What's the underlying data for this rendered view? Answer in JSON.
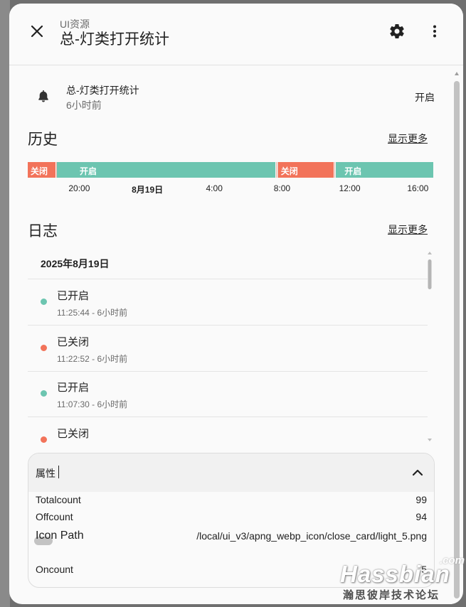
{
  "header": {
    "subtitle": "UI资源",
    "title": "总-灯类打开统计",
    "close_icon": "close-icon",
    "settings_icon": "gear-icon",
    "more_icon": "more-vertical-icon"
  },
  "entity": {
    "icon": "bell-icon",
    "name": "总-灯类打开统计",
    "last_changed": "6小时前",
    "state": "开启"
  },
  "history": {
    "title": "历史",
    "show_more": "显示更多",
    "segments": [
      {
        "state": "off",
        "label": "关闭",
        "start": 0.0,
        "end": 0.068
      },
      {
        "state": "on",
        "label": "开启",
        "start": 0.072,
        "end": 0.61
      },
      {
        "state": "off",
        "label": "关闭",
        "start": 0.617,
        "end": 0.755
      },
      {
        "state": "on",
        "label": "开启",
        "start": 0.76,
        "end": 1.0
      }
    ],
    "ticks": [
      {
        "label": "20:00",
        "pos": 0.127,
        "bold": false
      },
      {
        "label": "8月19日",
        "pos": 0.295,
        "bold": true
      },
      {
        "label": "4:00",
        "pos": 0.46,
        "bold": false
      },
      {
        "label": "8:00",
        "pos": 0.627,
        "bold": false
      },
      {
        "label": "12:00",
        "pos": 0.794,
        "bold": false
      },
      {
        "label": "16:00",
        "pos": 0.962,
        "bold": false
      }
    ]
  },
  "logbook": {
    "title": "日志",
    "show_more": "显示更多",
    "date": "2025年8月19日",
    "entries": [
      {
        "message": "已开启",
        "time": "11:25:44 - 6小时前",
        "state": "on"
      },
      {
        "message": "已关闭",
        "time": "11:22:52 - 6小时前",
        "state": "off"
      },
      {
        "message": "已开启",
        "time": "11:07:30 - 6小时前",
        "state": "on"
      },
      {
        "message": "已关闭",
        "time": "",
        "state": "off"
      }
    ]
  },
  "attributes": {
    "title": "属性",
    "rows": [
      {
        "key": "Totalcount",
        "value": "99"
      },
      {
        "key": "Offcount",
        "value": "94"
      },
      {
        "key": "Icon Path",
        "value": "/local/ui_v3/apng_webp_icon/close_card/light_5.png"
      },
      {
        "key": "Oncount",
        "value": "5"
      }
    ]
  },
  "watermark": {
    "com": ".com",
    "brand": "Hassbian",
    "forum": "瀚思彼岸技术论坛"
  },
  "colors": {
    "on": "#6cc5b0",
    "off": "#f2735a",
    "text": "#212121",
    "secondary": "#6b6b6b"
  }
}
